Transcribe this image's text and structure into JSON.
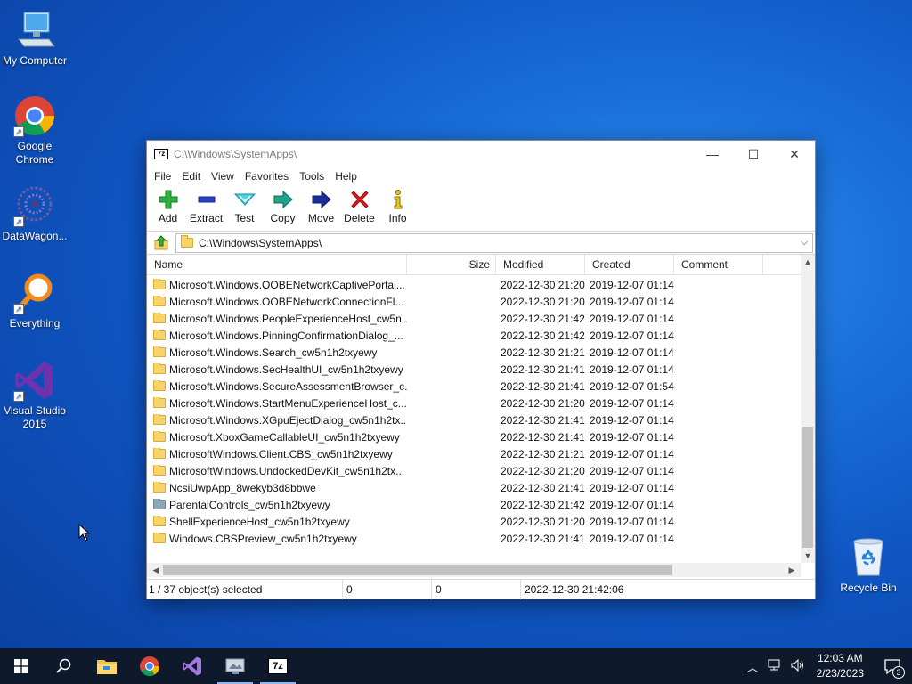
{
  "desktop": {
    "icons": [
      {
        "label": "My Computer",
        "icon": "computer-icon"
      },
      {
        "label": "Google Chrome",
        "icon": "chrome-icon"
      },
      {
        "label": "DataWagon...",
        "icon": "datawagon-icon"
      },
      {
        "label": "Everything",
        "icon": "everything-search-icon"
      },
      {
        "label": "Visual Studio 2015",
        "icon": "visual-studio-icon"
      },
      {
        "label": "Recycle Bin",
        "icon": "recycle-bin-icon"
      }
    ]
  },
  "window": {
    "title": "C:\\Windows\\SystemApps\\",
    "app_icon_text": "7z",
    "menu": [
      "File",
      "Edit",
      "View",
      "Favorites",
      "Tools",
      "Help"
    ],
    "toolbar": [
      {
        "label": "Add",
        "icon": "add-plus-icon"
      },
      {
        "label": "Extract",
        "icon": "extract-minus-icon"
      },
      {
        "label": "Test",
        "icon": "test-check-icon"
      },
      {
        "label": "Copy",
        "icon": "copy-arrow-icon"
      },
      {
        "label": "Move",
        "icon": "move-arrow-icon"
      },
      {
        "label": "Delete",
        "icon": "delete-x-icon"
      },
      {
        "label": "Info",
        "icon": "info-icon"
      }
    ],
    "address": "C:\\Windows\\SystemApps\\",
    "columns": [
      "Name",
      "Size",
      "Modified",
      "Created",
      "Comment"
    ],
    "rows": [
      {
        "name": "Microsoft.Windows.OOBENetworkCaptivePortal...",
        "size": "",
        "modified": "2022-12-30 21:20",
        "created": "2019-12-07 01:14",
        "icon": "folder"
      },
      {
        "name": "Microsoft.Windows.OOBENetworkConnectionFl...",
        "size": "",
        "modified": "2022-12-30 21:20",
        "created": "2019-12-07 01:14",
        "icon": "folder"
      },
      {
        "name": "Microsoft.Windows.PeopleExperienceHost_cw5n...",
        "size": "",
        "modified": "2022-12-30 21:42",
        "created": "2019-12-07 01:14",
        "icon": "folder"
      },
      {
        "name": "Microsoft.Windows.PinningConfirmationDialog_...",
        "size": "",
        "modified": "2022-12-30 21:42",
        "created": "2019-12-07 01:14",
        "icon": "folder"
      },
      {
        "name": "Microsoft.Windows.Search_cw5n1h2txyewy",
        "size": "",
        "modified": "2022-12-30 21:21",
        "created": "2019-12-07 01:14",
        "icon": "folder"
      },
      {
        "name": "Microsoft.Windows.SecHealthUI_cw5n1h2txyewy",
        "size": "",
        "modified": "2022-12-30 21:41",
        "created": "2019-12-07 01:14",
        "icon": "folder"
      },
      {
        "name": "Microsoft.Windows.SecureAssessmentBrowser_c...",
        "size": "",
        "modified": "2022-12-30 21:41",
        "created": "2019-12-07 01:54",
        "icon": "folder"
      },
      {
        "name": "Microsoft.Windows.StartMenuExperienceHost_c...",
        "size": "",
        "modified": "2022-12-30 21:20",
        "created": "2019-12-07 01:14",
        "icon": "folder"
      },
      {
        "name": "Microsoft.Windows.XGpuEjectDialog_cw5n1h2tx...",
        "size": "",
        "modified": "2022-12-30 21:41",
        "created": "2019-12-07 01:14",
        "icon": "folder"
      },
      {
        "name": "Microsoft.XboxGameCallableUI_cw5n1h2txyewy",
        "size": "",
        "modified": "2022-12-30 21:41",
        "created": "2019-12-07 01:14",
        "icon": "folder"
      },
      {
        "name": "MicrosoftWindows.Client.CBS_cw5n1h2txyewy",
        "size": "",
        "modified": "2022-12-30 21:21",
        "created": "2019-12-07 01:14",
        "icon": "folder"
      },
      {
        "name": "MicrosoftWindows.UndockedDevKit_cw5n1h2tx...",
        "size": "",
        "modified": "2022-12-30 21:20",
        "created": "2019-12-07 01:14",
        "icon": "folder"
      },
      {
        "name": "NcsiUwpApp_8wekyb3d8bbwe",
        "size": "",
        "modified": "2022-12-30 21:41",
        "created": "2019-12-07 01:14",
        "icon": "folder"
      },
      {
        "name": "ParentalControls_cw5n1h2txyewy",
        "size": "",
        "modified": "2022-12-30 21:42",
        "created": "2019-12-07 01:14",
        "icon": "folder-gray"
      },
      {
        "name": "ShellExperienceHost_cw5n1h2txyewy",
        "size": "",
        "modified": "2022-12-30 21:20",
        "created": "2019-12-07 01:14",
        "icon": "folder"
      },
      {
        "name": "Windows.CBSPreview_cw5n1h2txyewy",
        "size": "",
        "modified": "2022-12-30 21:41",
        "created": "2019-12-07 01:14",
        "icon": "folder"
      }
    ],
    "status": {
      "selection": "1 / 37 object(s) selected",
      "size1": "0",
      "size2": "0",
      "modified": "2022-12-30 21:42:06"
    }
  },
  "taskbar": {
    "apps": [
      "start-icon",
      "search-icon",
      "file-explorer-icon",
      "chrome-icon",
      "visual-studio-icon",
      "screenshot-tool-icon",
      "7zip-icon"
    ],
    "time": "12:03 AM",
    "date": "2/23/2023",
    "notification_count": "3"
  }
}
